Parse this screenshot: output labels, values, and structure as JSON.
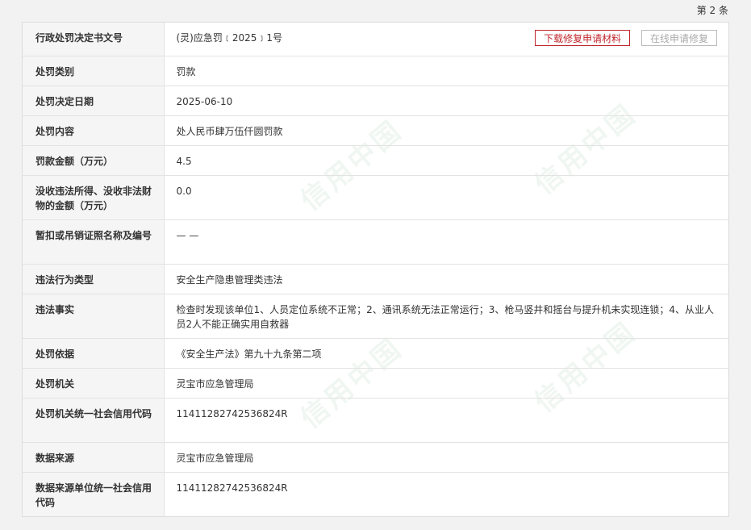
{
  "header": {
    "page_count": "第 2 条"
  },
  "buttons": {
    "download": "下载修复申请材料",
    "online": "在线申请修复"
  },
  "rows": [
    {
      "label": "行政处罚决定书文号",
      "value": "(灵)应急罚﹝2025﹞1号"
    },
    {
      "label": "处罚类别",
      "value": "罚款"
    },
    {
      "label": "处罚决定日期",
      "value": "2025-06-10"
    },
    {
      "label": "处罚内容",
      "value": "处人民币肆万伍仟圆罚款"
    },
    {
      "label": "罚款金额（万元）",
      "value": "4.5"
    },
    {
      "label": "没收违法所得、没收非法财物的金额（万元）",
      "value": "0.0"
    },
    {
      "label": "暂扣或吊销证照名称及编号",
      "value": "— —"
    },
    {
      "label": "违法行为类型",
      "value": "安全生产隐患管理类违法"
    },
    {
      "label": "违法事实",
      "value": "检查时发现该单位1、人员定位系统不正常；2、通讯系统无法正常运行；3、枪马竖井和摇台与提升机未实现连锁；4、从业人员2人不能正确实用自救器"
    },
    {
      "label": "处罚依据",
      "value": "《安全生产法》第九十九条第二项"
    },
    {
      "label": "处罚机关",
      "value": "灵宝市应急管理局"
    },
    {
      "label": "处罚机关统一社会信用代码",
      "value": "11411282742536824R"
    },
    {
      "label": "数据来源",
      "value": "灵宝市应急管理局"
    },
    {
      "label": "数据来源单位统一社会信用代码",
      "value": "11411282742536824R"
    }
  ],
  "watermark": {
    "text": "信用中国"
  }
}
